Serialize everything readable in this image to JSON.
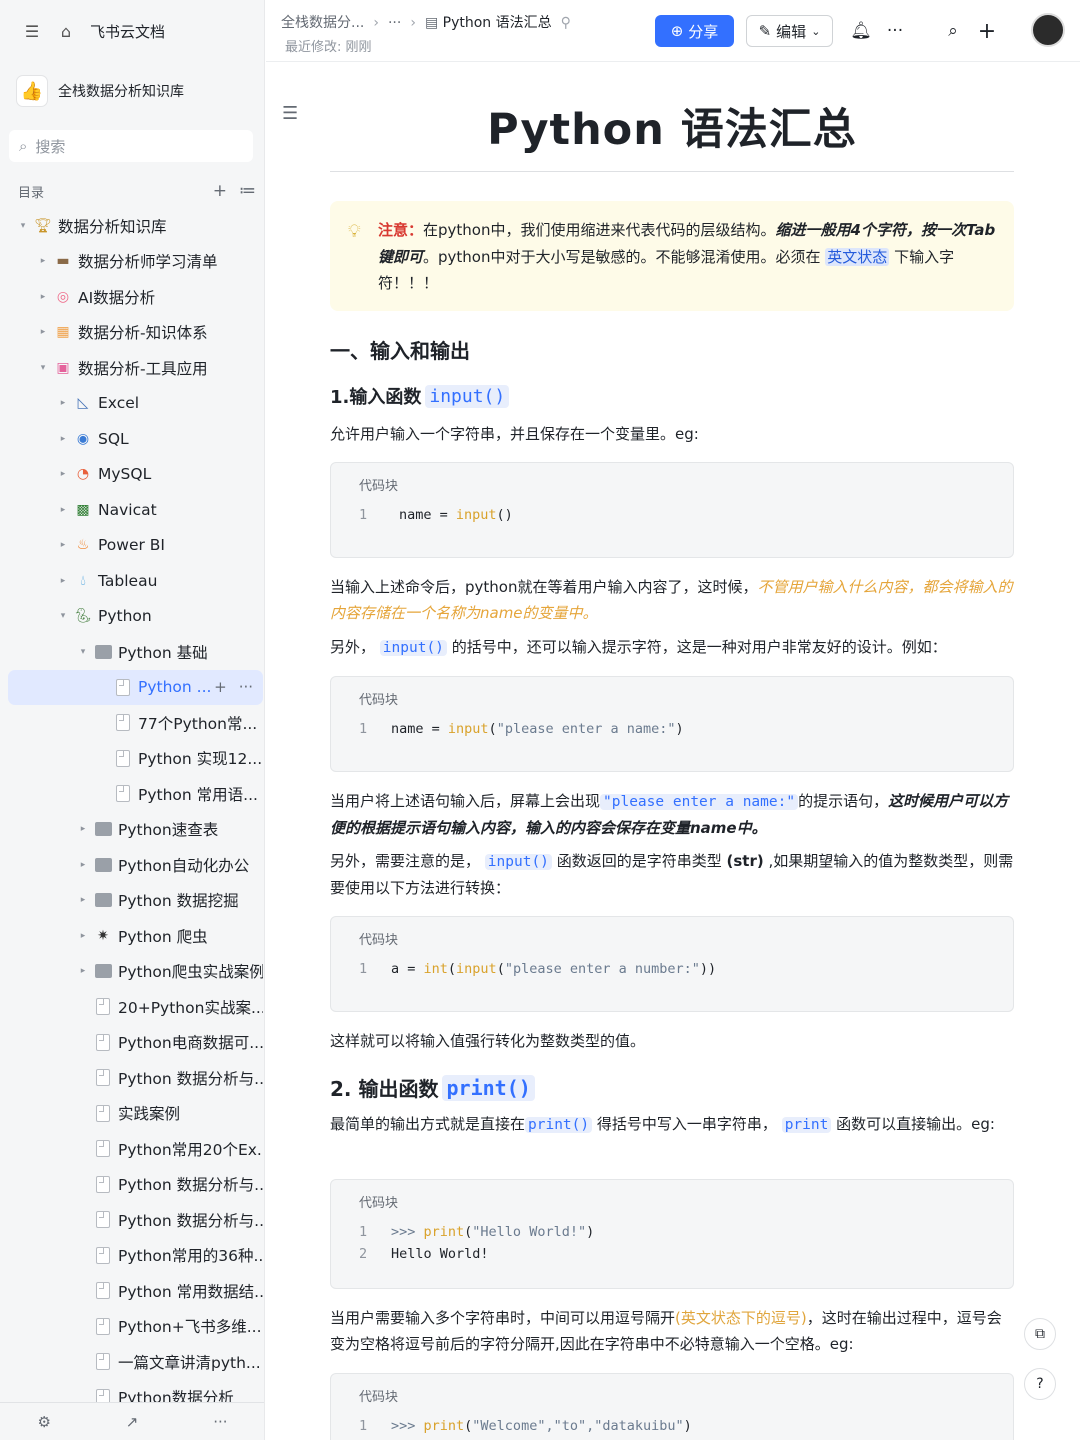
{
  "app": {
    "name": "飞书云文档"
  },
  "kb": {
    "name": "全栈数据分析知识库"
  },
  "search": {
    "placeholder": "搜索"
  },
  "toc": {
    "label": "目录"
  },
  "tree": [
    {
      "label": "数据分析知识库",
      "level": 0,
      "icon": "trophy-icon",
      "caret": "▾"
    },
    {
      "label": "数据分析师学习清单",
      "level": 1,
      "icon": "scroll-icon",
      "caret": "▸"
    },
    {
      "label": "AI数据分析",
      "level": 1,
      "icon": "ai-icon",
      "caret": "▸"
    },
    {
      "label": "数据分析-知识体系",
      "level": 1,
      "icon": "grid-icon",
      "caret": "▸"
    },
    {
      "label": "数据分析-工具应用",
      "level": 1,
      "icon": "tools-icon",
      "caret": "▾"
    },
    {
      "label": "Excel",
      "level": 2,
      "icon": "excel-icon",
      "caret": "▸"
    },
    {
      "label": "SQL",
      "level": 2,
      "icon": "sql-icon",
      "caret": "▸"
    },
    {
      "label": "MySQL",
      "level": 2,
      "icon": "mysql-icon",
      "caret": "▸"
    },
    {
      "label": "Navicat",
      "level": 2,
      "icon": "navicat-icon",
      "caret": "▸"
    },
    {
      "label": "Power BI",
      "level": 2,
      "icon": "fire-icon",
      "caret": "▸"
    },
    {
      "label": "Tableau",
      "level": 2,
      "icon": "droplet-icon",
      "caret": "▸"
    },
    {
      "label": "Python",
      "level": 2,
      "icon": "python-icon",
      "caret": "▾"
    },
    {
      "label": "Python 基础",
      "level": 3,
      "icon": "folder-icon",
      "caret": "▾"
    },
    {
      "label": "Python ...",
      "level": 4,
      "icon": "doc-icon",
      "caret": "",
      "selected": true
    },
    {
      "label": "77个Python常...",
      "level": 4,
      "icon": "doc-icon",
      "caret": ""
    },
    {
      "label": "Python 实现12...",
      "level": 4,
      "icon": "doc-icon",
      "caret": ""
    },
    {
      "label": "Python 常用语...",
      "level": 4,
      "icon": "doc-icon",
      "caret": ""
    },
    {
      "label": "Python速查表",
      "level": 3,
      "icon": "folder-icon",
      "caret": "▸"
    },
    {
      "label": "Python自动化办公",
      "level": 3,
      "icon": "folder-icon",
      "caret": "▸"
    },
    {
      "label": "Python 数据挖掘",
      "level": 3,
      "icon": "folder-icon",
      "caret": "▸"
    },
    {
      "label": "Python 爬虫",
      "level": 3,
      "icon": "spider-icon",
      "caret": "▸"
    },
    {
      "label": "Python爬虫实战案例",
      "level": 3,
      "icon": "folder-icon",
      "caret": "▸"
    },
    {
      "label": "20+Python实战案...",
      "level": 3,
      "icon": "doc-icon",
      "caret": ""
    },
    {
      "label": "Python电商数据可...",
      "level": 3,
      "icon": "doc-icon",
      "caret": ""
    },
    {
      "label": "Python 数据分析与...",
      "level": 3,
      "icon": "doc-icon",
      "caret": ""
    },
    {
      "label": "实践案例",
      "level": 3,
      "icon": "doc-icon",
      "caret": ""
    },
    {
      "label": "Python常用20个Ex...",
      "level": 3,
      "icon": "doc-icon",
      "caret": ""
    },
    {
      "label": "Python 数据分析与...",
      "level": 3,
      "icon": "doc-icon",
      "caret": ""
    },
    {
      "label": "Python 数据分析与...",
      "level": 3,
      "icon": "doc-icon",
      "caret": ""
    },
    {
      "label": "Python常用的36种...",
      "level": 3,
      "icon": "doc-icon",
      "caret": ""
    },
    {
      "label": "Python 常用数据结...",
      "level": 3,
      "icon": "doc-icon",
      "caret": ""
    },
    {
      "label": "Python+飞书多维...",
      "level": 3,
      "icon": "doc-icon",
      "caret": ""
    },
    {
      "label": "一篇文章讲清pyth...",
      "level": 3,
      "icon": "doc-icon",
      "caret": ""
    },
    {
      "label": "Python数据分析",
      "level": 3,
      "icon": "doc-icon",
      "caret": ""
    }
  ],
  "header": {
    "crumb1": "全栈数据分...",
    "crumb2": "···",
    "crumb3": "Python 语法汇总",
    "last_modified": "最近修改: 刚刚",
    "share": "分享",
    "edit": "编辑"
  },
  "doc": {
    "title": "Python 语法汇总",
    "callout": {
      "warn": "注意：",
      "t1": "在python中，我们使用缩进来代表代码的层级结构。",
      "t2": "缩进一般用4个字符，按一次Tab键即可",
      "t3": "。python中对于大小写是敏感的。不能够混淆使用。必须在",
      "t4": "英文状态",
      "t5": "下输入字符！！！"
    },
    "h_io": "一、输入和输出",
    "h_input": "1.输入函数",
    "h_input_code": "input()",
    "p1": "允许用户输入一个字符串，并且保存在一个变量里。eg:",
    "codeblock_label": "代码块",
    "code1": {
      "n": "1",
      "a": "name = ",
      "f": "input",
      "b": "()"
    },
    "p2a": "当输入上述命令后，python就在等着用户输入内容了，这时候，",
    "p2b": "不管用户输入什么内容，都会将输入的内容存储在一个名称为name的变量中。",
    "p3a": "另外，",
    "p3code": "input()",
    "p3b": "的括号中，还可以输入提示字符，这是一种对用户非常友好的设计。例如：",
    "code2": {
      "n": "1",
      "a": "name = ",
      "f": "input",
      "b": "(",
      "s": "\"please enter a name:\"",
      "c": ")"
    },
    "p4a": "当用户将上述语句输入后，屏幕上会出现",
    "p4code": "\"please enter a name:\"",
    "p4b": "的提示语句，",
    "p4c": "这时候用户可以方便的根据提示语句输入内容，输入的内容会保存在变量name中。",
    "p5a": "另外，需要注意的是，",
    "p5code": "input()",
    "p5b": "函数返回的是字符串类型",
    "p5c": "(str)",
    "p5d": ",如果期望输入的值为整数类型，则需要使用以下方法进行转换：",
    "code3": {
      "n": "1",
      "a": "a = ",
      "f1": "int",
      "b": "(",
      "f2": "input",
      "c": "(",
      "s": "\"please enter a number:\"",
      "d": "))"
    },
    "p6": "这样就可以将输入值强行转化为整数类型的值。",
    "h_print": "2. 输出函数",
    "h_print_code": "print()",
    "p7a": "最简单的输出方式就是直接在",
    "p7code": "print()",
    "p7b": "得括号中写入一串字符串，",
    "p7code2": "print",
    "p7c": "函数可以直接输出。eg:",
    "code4": {
      "n1": "1",
      "p1": ">>> ",
      "f": "print",
      "b": "(",
      "s": "\"Hello World!\"",
      "c": ")",
      "n2": "2",
      "out": "Hello World!"
    },
    "p8a": "当用户需要输入多个字符串时，中间可以用逗号隔开",
    "p8b": "(英文状态下的逗号)",
    "p8c": "，这时在输出过程中，逗号会变为空格将逗号前后的字符分隔开,因此在字符串中不必特意输入一个空格。eg:",
    "code5": {
      "n": "1",
      "p": ">>> ",
      "f": "print",
      "b": "(",
      "s": "\"Welcome\",\"to\",\"datakuibu\"",
      "c": ")"
    }
  },
  "colors": {
    "accent": "#3370ff",
    "callout_bg": "#fefbe8",
    "warn": "#d83931",
    "highlight": "#e5a53a"
  }
}
